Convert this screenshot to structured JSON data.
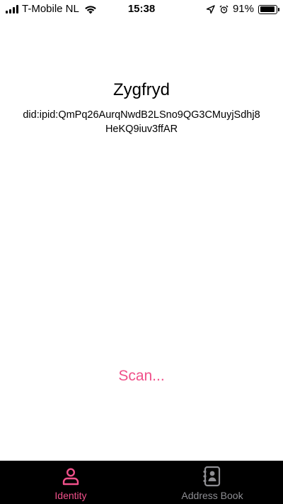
{
  "status_bar": {
    "carrier": "T-Mobile NL",
    "time": "15:38",
    "battery_percent_label": "91%",
    "battery_level": 0.91,
    "signal_bars": 4,
    "icons": [
      "signal-icon",
      "wifi-icon",
      "location-arrow-icon",
      "alarm-clock-icon",
      "battery-icon"
    ]
  },
  "identity": {
    "name": "Zygfryd",
    "did": "did:ipid:QmPq26AurqNwdB2LSno9QG3CMuyjSdhj8HeKQ9iuv3ffAR"
  },
  "actions": {
    "scan_label": "Scan..."
  },
  "tab_bar": {
    "tabs": [
      {
        "label": "Identity",
        "icon": "person-icon",
        "active": true
      },
      {
        "label": "Address Book",
        "icon": "contact-book-icon",
        "active": false
      }
    ]
  },
  "colors": {
    "accent": "#f0508a",
    "tab_inactive": "#8e8e93",
    "tab_bar_bg": "#000000",
    "background": "#ffffff"
  }
}
